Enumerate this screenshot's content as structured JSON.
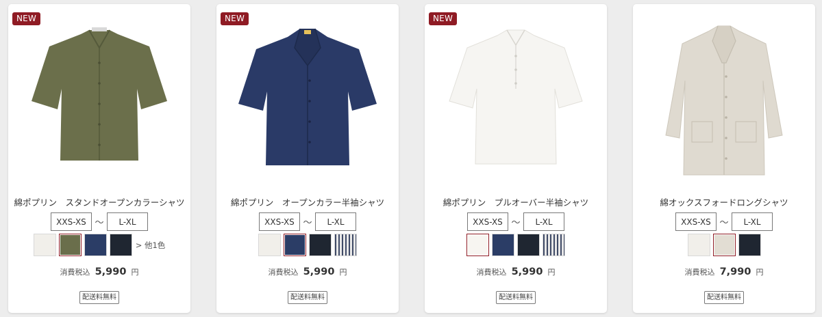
{
  "products": [
    {
      "badge": "NEW",
      "name": "綿ポプリン　スタンドオープンカラーシャツ",
      "size_from": "XXS-XS",
      "size_sep": "〜",
      "size_to": "L-XL",
      "swatches": [
        "#f1efea",
        "#6a6e4b",
        "#2b3d66",
        "#1f2631"
      ],
      "selected_swatch": 1,
      "more_colors": "> 他1色",
      "price_label": "消費税込",
      "price": "5,990",
      "currency": "円",
      "shipping": "配送料無料",
      "garment_color": "#6b6f4b",
      "garment_type": "stand-collar-shirt"
    },
    {
      "badge": "NEW",
      "name": "綿ポプリン　オープンカラー半袖シャツ",
      "size_from": "XXS-XS",
      "size_sep": "〜",
      "size_to": "L-XL",
      "swatches": [
        "#f1efea",
        "#2b3d66",
        "#1f2631",
        "stripe"
      ],
      "selected_swatch": 1,
      "more_colors": "",
      "price_label": "消費税込",
      "price": "5,990",
      "currency": "円",
      "shipping": "配送料無料",
      "garment_color": "#2a3a67",
      "garment_type": "open-collar-shirt"
    },
    {
      "badge": "NEW",
      "name": "綿ポプリン　プルオーバー半袖シャツ",
      "size_from": "XXS-XS",
      "size_sep": "〜",
      "size_to": "L-XL",
      "swatches": [
        "#f7f5f1",
        "#2b3d66",
        "#1f2631",
        "stripe"
      ],
      "selected_swatch": 0,
      "more_colors": "",
      "price_label": "消費税込",
      "price": "5,990",
      "currency": "円",
      "shipping": "配送料無料",
      "garment_color": "#f6f5f2",
      "garment_type": "pullover-shirt"
    },
    {
      "badge": "",
      "name": "綿オックスフォードロングシャツ",
      "size_from": "XXS-XS",
      "size_sep": "〜",
      "size_to": "L-XL",
      "swatches": [
        "#f1efea",
        "#e2ddd3",
        "#1f2631"
      ],
      "selected_swatch": 1,
      "more_colors": "",
      "price_label": "消費税込",
      "price": "7,990",
      "currency": "円",
      "shipping": "配送料無料",
      "garment_color": "#dfdad0",
      "garment_type": "long-shirt-coat"
    }
  ]
}
